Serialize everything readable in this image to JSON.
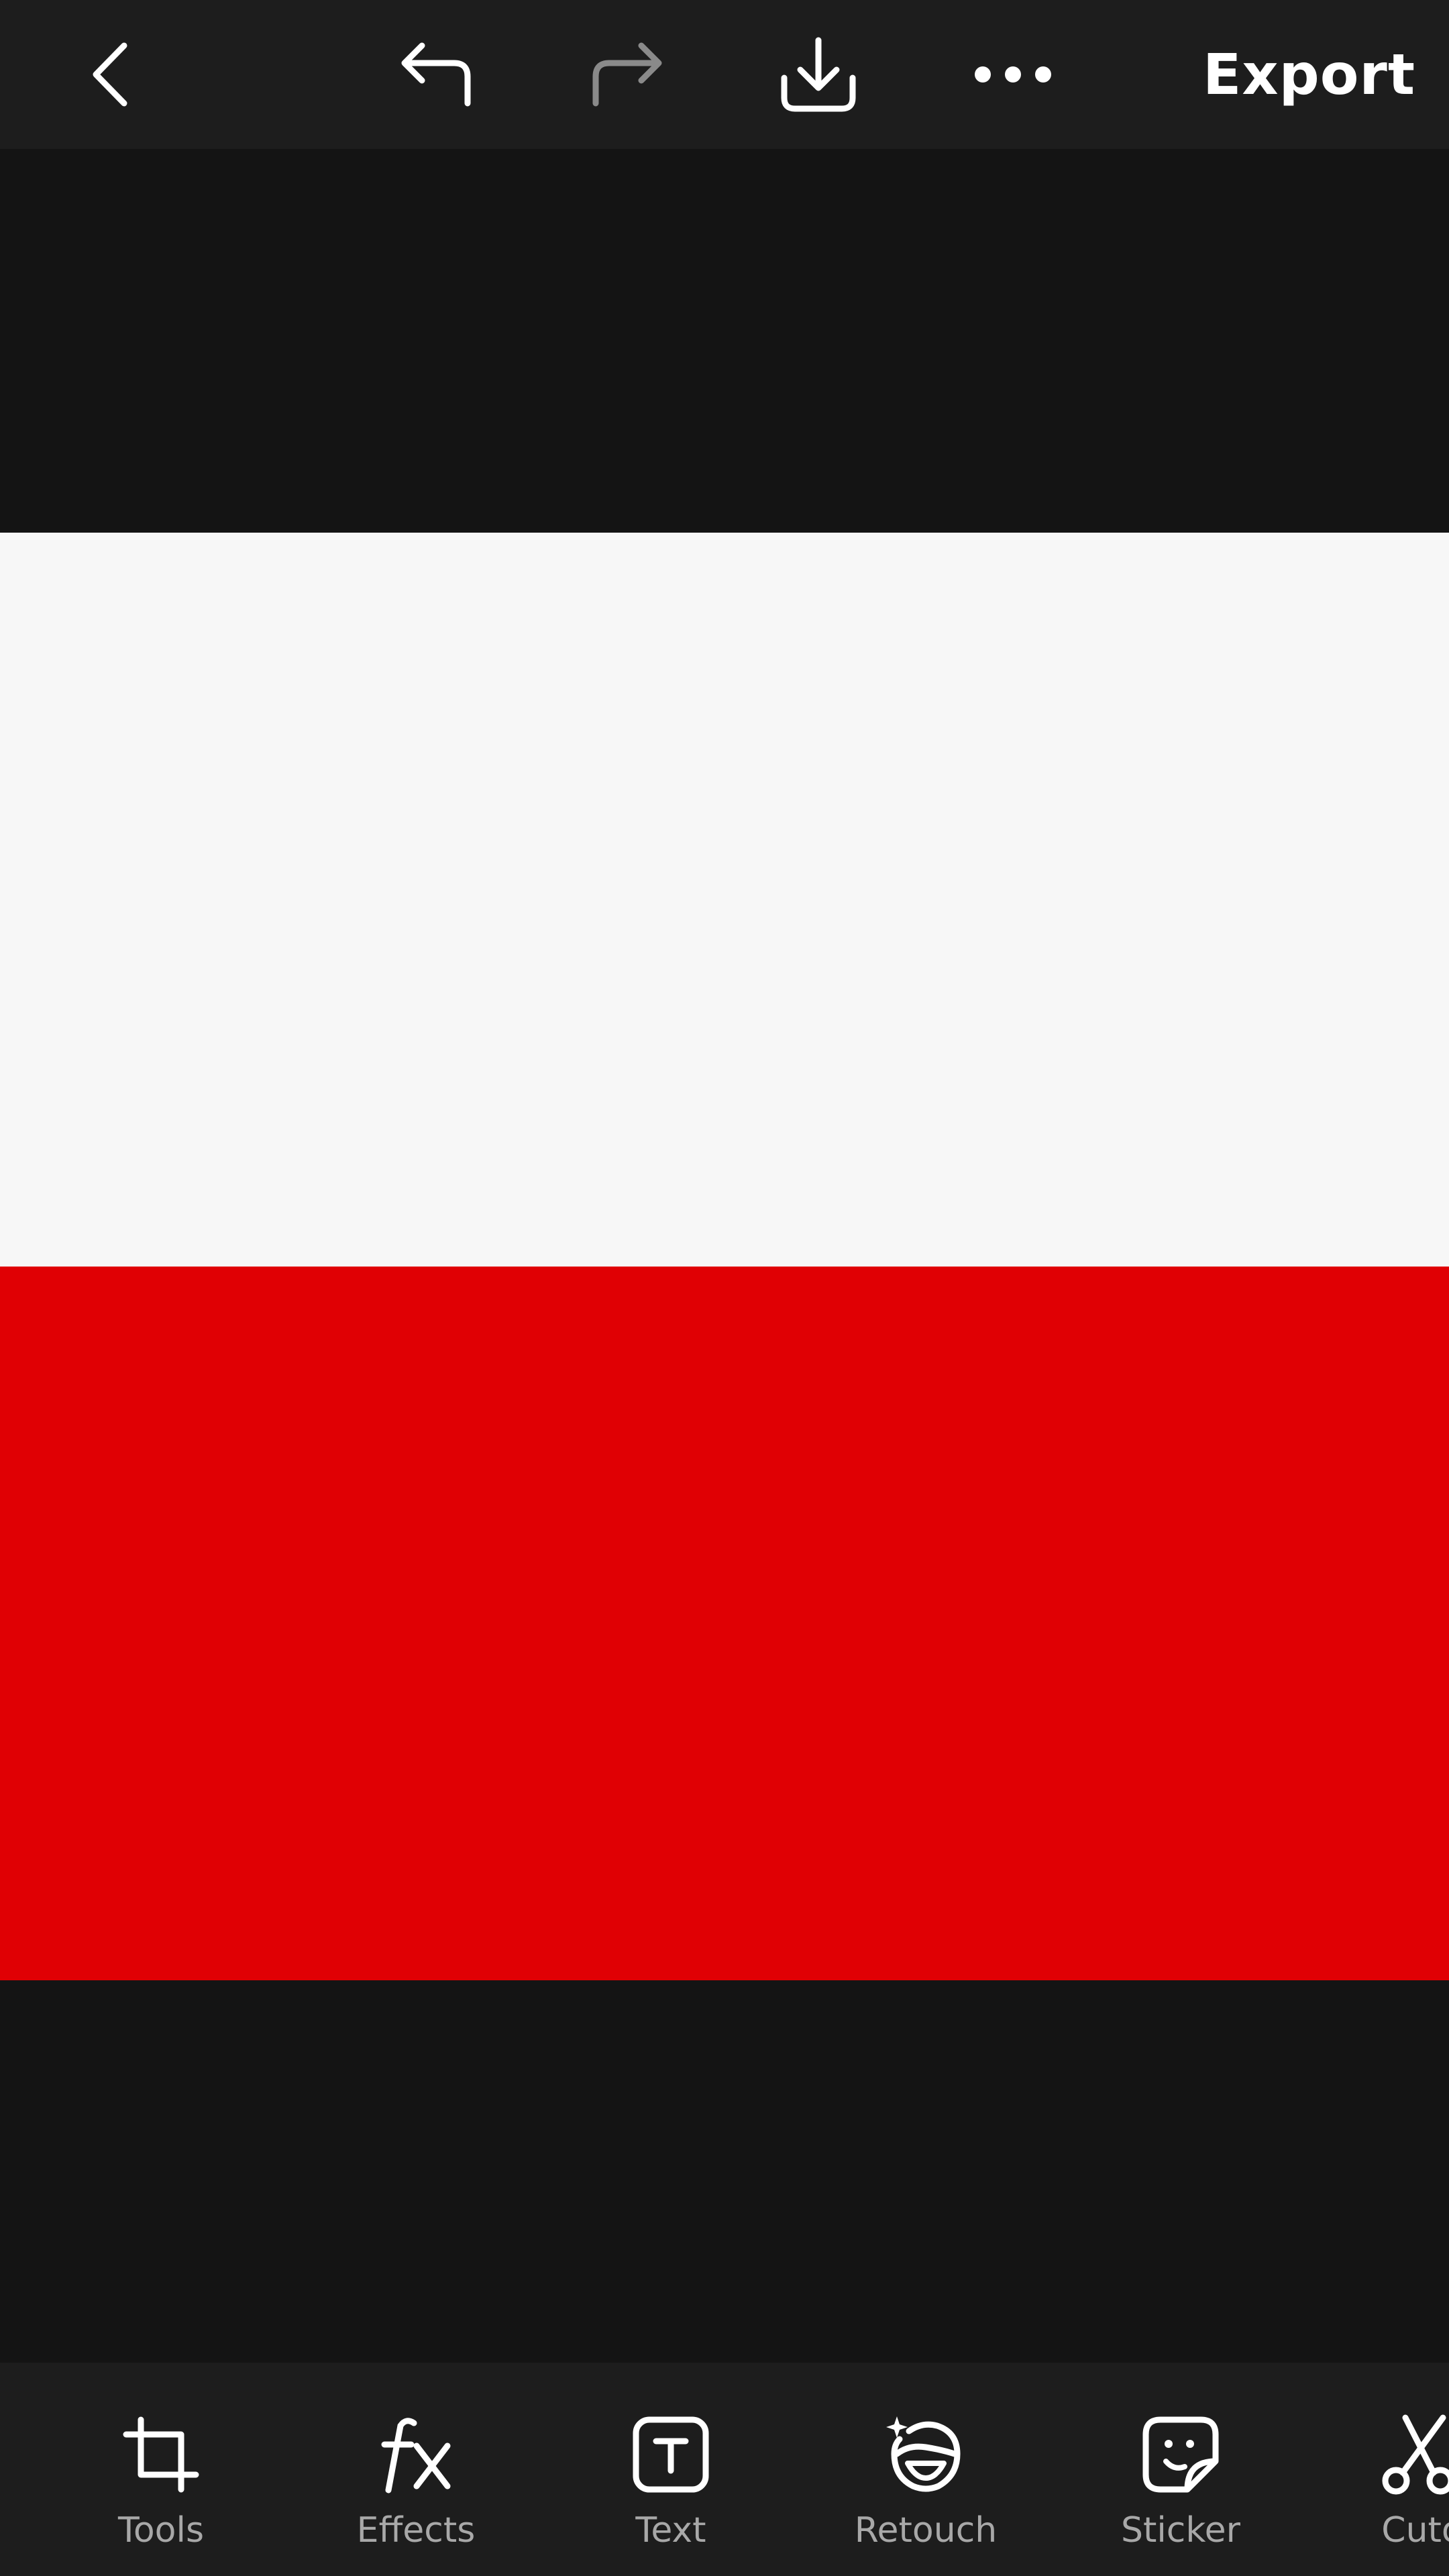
{
  "topbar": {
    "export_label": "Export",
    "icons": {
      "back": "chevron-left-icon",
      "undo": "undo-icon",
      "redo": "redo-icon",
      "download": "download-icon",
      "more": "more-icon"
    }
  },
  "canvas": {
    "image": {
      "stripes": [
        {
          "name": "white",
          "color": "#f7f7f7"
        },
        {
          "name": "red",
          "color": "#e00004"
        }
      ]
    }
  },
  "toolbar": {
    "items": [
      {
        "label": "Tools",
        "icon": "crop-icon"
      },
      {
        "label": "Effects",
        "icon": "fx-icon"
      },
      {
        "label": "Text",
        "icon": "text-box-icon"
      },
      {
        "label": "Retouch",
        "icon": "retouch-face-icon"
      },
      {
        "label": "Sticker",
        "icon": "sticker-icon"
      },
      {
        "label": "Cuto",
        "icon": "scissors-icon"
      }
    ]
  },
  "colors": {
    "background": "#141414",
    "bars": "#1d1d1d",
    "redo_disabled": "#8a8a8a",
    "label": "#a8a8a8"
  }
}
